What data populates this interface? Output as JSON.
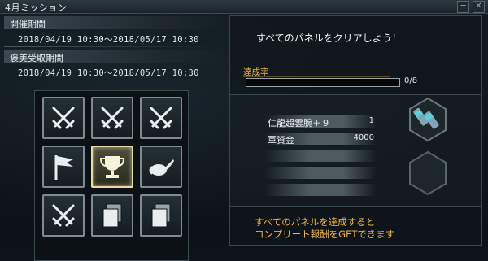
{
  "window": {
    "title": "4月ミッション",
    "minimize_label": "─",
    "close_label": "✕"
  },
  "left_panel": {
    "event_period_label": "開催期間",
    "event_period_value": "2018/04/19 10:30〜2018/05/17 10:30",
    "reward_period_label": "褒美受取期間",
    "reward_period_value": "2018/04/19 10:30〜2018/05/17 10:30"
  },
  "panels": [
    {
      "icon": "crossed-swords-icon",
      "selected": false
    },
    {
      "icon": "crossed-swords-icon",
      "selected": false
    },
    {
      "icon": "crossed-swords-icon",
      "selected": false
    },
    {
      "icon": "flag-icon",
      "selected": false
    },
    {
      "icon": "trophy-icon",
      "selected": true
    },
    {
      "icon": "watering-can-icon",
      "selected": false
    },
    {
      "icon": "crossed-swords-icon",
      "selected": false
    },
    {
      "icon": "cards-icon",
      "selected": false
    },
    {
      "icon": "cards-icon",
      "selected": false
    }
  ],
  "right_panel": {
    "goal_text": "すべてのパネルをクリアしよう！",
    "rate_label": "達成率",
    "progress": {
      "current": 0,
      "total": 8,
      "text": "0/8"
    },
    "rewards": [
      {
        "name": "仁龍超雲腕＋９",
        "qty": "1"
      },
      {
        "name": "軍資金",
        "qty": "4000"
      },
      {
        "name": "",
        "qty": ""
      },
      {
        "name": "",
        "qty": ""
      },
      {
        "name": "",
        "qty": ""
      }
    ],
    "complete_reward_icon": "gauntlet-icon",
    "footer_line1": "すべてのパネルを達成すると",
    "footer_line2": "コンプリート報酬をGETできます"
  },
  "colors": {
    "accent": "#f0b43c",
    "panel_border": "#7e8b91",
    "selected_border": "#e8dca6"
  }
}
